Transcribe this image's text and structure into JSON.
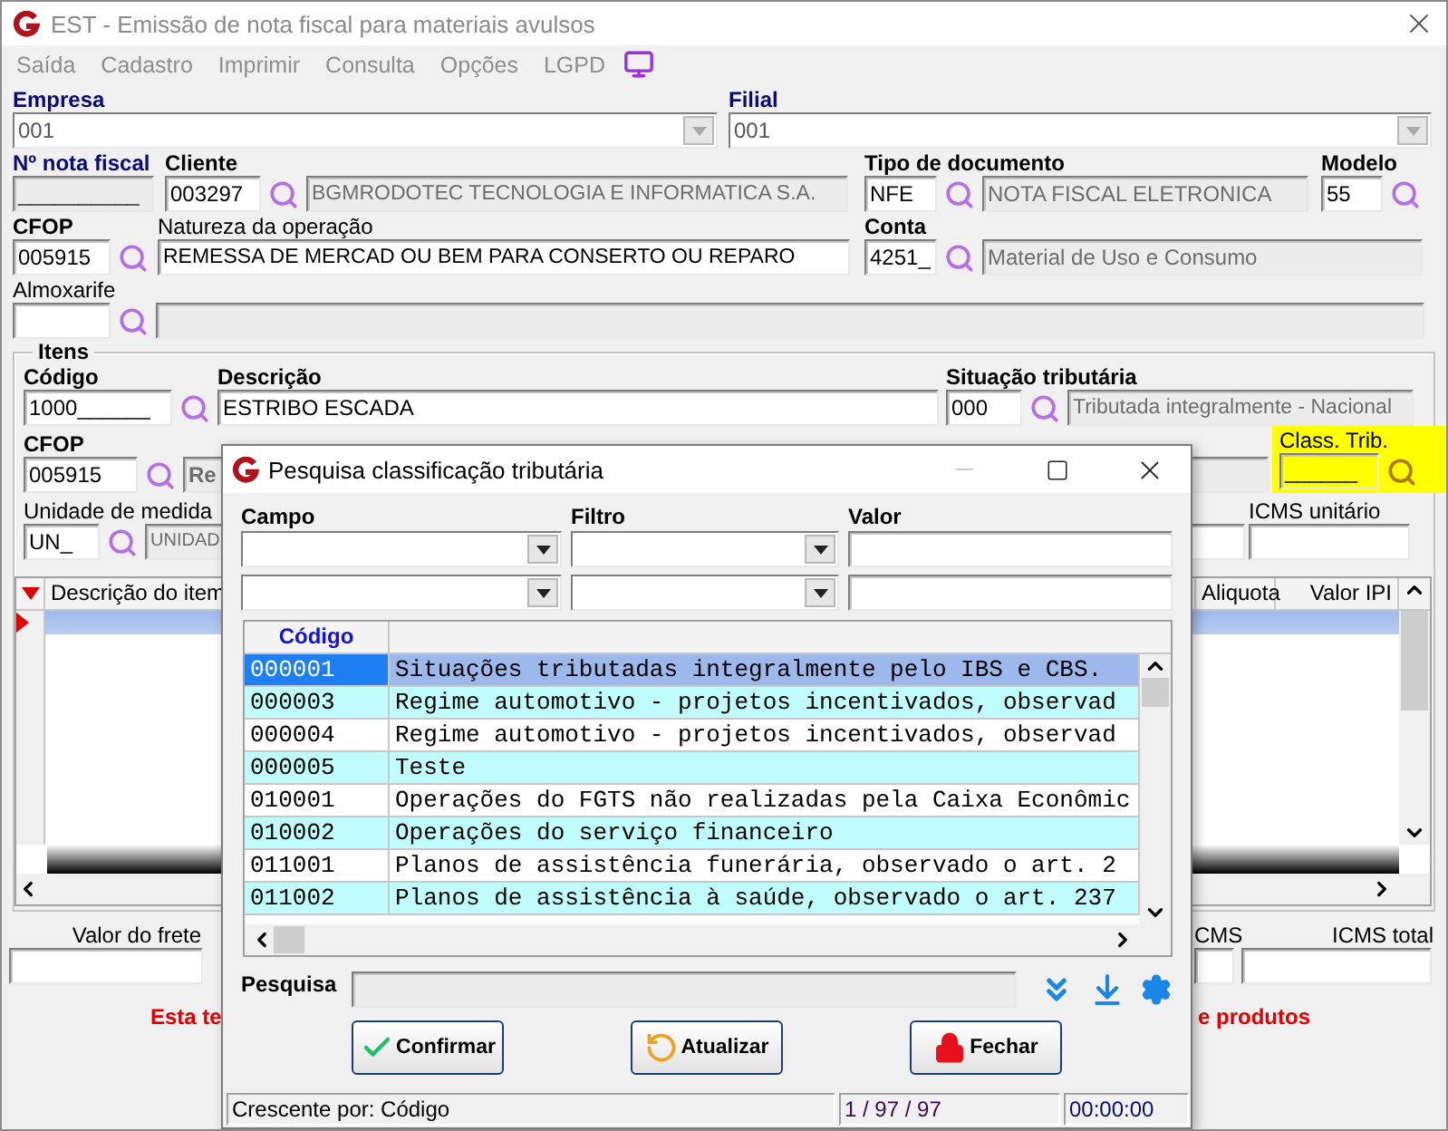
{
  "window": {
    "title": "EST - Emissão de nota fiscal para materiais avulsos"
  },
  "menu": [
    {
      "label": "Saída",
      "disabled": true
    },
    {
      "label": "Cadastro",
      "disabled": true
    },
    {
      "label": "Imprimir",
      "disabled": true
    },
    {
      "label": "Consulta",
      "disabled": true
    },
    {
      "label": "Opções",
      "disabled": true
    },
    {
      "label": "LGPD",
      "disabled": true
    }
  ],
  "empresa": {
    "label": "Empresa",
    "value": "001"
  },
  "filial": {
    "label": "Filial",
    "value": "001"
  },
  "nota_fiscal": {
    "label": "Nº nota fiscal",
    "value": "__________",
    "readonly": true
  },
  "cliente": {
    "label": "Cliente",
    "code": "003297",
    "name": "BGMRODOTEC TECNOLOGIA E INFORMATICA S.A."
  },
  "tipo_documento": {
    "label": "Tipo de documento",
    "code": "NFE",
    "name": "NOTA FISCAL ELETRONICA"
  },
  "modelo": {
    "label": "Modelo",
    "value": "55"
  },
  "cfop": {
    "label": "CFOP",
    "value": "005915"
  },
  "natureza": {
    "label": "Natureza da operação",
    "value": "REMESSA DE MERCAD OU BEM PARA CONSERTO OU REPARO"
  },
  "conta": {
    "label": "Conta",
    "code": "4251_",
    "name": "Material de Uso e Consumo"
  },
  "almoxarife": {
    "label": "Almoxarife"
  },
  "itens": {
    "legend": "Itens",
    "codigo": {
      "label": "Código",
      "value": "1000______"
    },
    "descricao": {
      "label": "Descrição",
      "value": "ESTRIBO ESCADA"
    },
    "situacao": {
      "label": "Situação tributária",
      "code": "000",
      "name": "Tributada integralmente - Nacional"
    },
    "cfop": {
      "label": "CFOP",
      "code": "005915",
      "name": "Re"
    },
    "class_trib": {
      "label": "Class. Trib.",
      "value": "______",
      "highlighted": true
    },
    "unidade": {
      "label": "Unidade de medida",
      "code": "UN_",
      "name": "UNIDAD"
    },
    "icms_unitario_label": "ICMS unitário",
    "grid": {
      "columns": [
        "Descrição do item",
        "Aliquota",
        "Valor IPI"
      ],
      "rows": [
        {
          "selected": true
        }
      ]
    }
  },
  "totals": {
    "frete_label": "Valor do frete",
    "icms_label": "CMS",
    "icms_total_label": "ICMS total"
  },
  "warning": [
    "Esta te",
    "e produtos"
  ],
  "dialog": {
    "title": "Pesquisa classificação tributária",
    "labels": [
      "Campo",
      "Filtro",
      "Valor"
    ],
    "columns": [
      "Código"
    ],
    "rows": [
      {
        "code": "000001",
        "description": "Situações tributadas integralmente pelo IBS e CBS.",
        "selected": true
      },
      {
        "code": "000003",
        "description": "Regime automotivo - projetos incentivados, observad",
        "selected": false
      },
      {
        "code": "000004",
        "description": "Regime automotivo - projetos incentivados, observad",
        "selected": false
      },
      {
        "code": "000005",
        "description": "Teste",
        "selected": false
      },
      {
        "code": "010001",
        "description": "Operações do FGTS não realizadas pela Caixa Econômic",
        "selected": false
      },
      {
        "code": "010002",
        "description": "Operações do serviço financeiro",
        "selected": false
      },
      {
        "code": "011001",
        "description": "Planos de assistência funerária, observado o art. 2",
        "selected": false
      },
      {
        "code": "011002",
        "description": "Planos de assistência à saúde, observado o art. 237",
        "selected": false
      }
    ],
    "search_label": "Pesquisa",
    "buttons": [
      {
        "kind": "confirm",
        "label": "Confirmar"
      },
      {
        "kind": "refresh",
        "label": "Atualizar"
      },
      {
        "kind": "close",
        "label": "Fechar"
      }
    ],
    "status": [
      "Crescente por: Código",
      "1 / 97 / 97",
      "00:00:00"
    ]
  }
}
